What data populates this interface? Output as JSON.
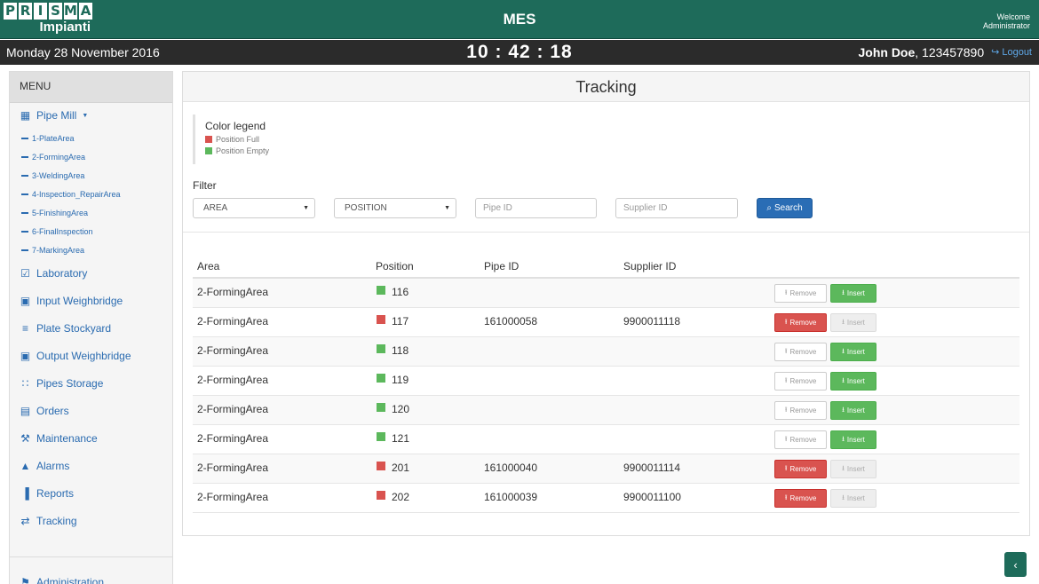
{
  "header": {
    "logo_letters": [
      "P",
      "R",
      "I",
      "S",
      "M",
      "A"
    ],
    "logo_sub": "Impianti",
    "app_title": "MES",
    "welcome": "Welcome",
    "user_role": "Administrator"
  },
  "status": {
    "date": "Monday 28 November 2016",
    "clock": "10 : 42 : 18",
    "user_name": "John Doe",
    "user_id": ", 123457890",
    "logout": "Logout"
  },
  "sidebar": {
    "title": "MENU",
    "pipe_mill": "Pipe Mill",
    "sub_items": [
      "1-PlateArea",
      "2-FormingArea",
      "3-WeldingArea",
      "4-Inspection_RepairArea",
      "5-FinishingArea",
      "6-FinalInspection",
      "7-MarkingArea"
    ],
    "items": [
      {
        "label": "Laboratory",
        "icon": "check-square-icon"
      },
      {
        "label": "Input Weighbridge",
        "icon": "weighbridge-icon"
      },
      {
        "label": "Plate Stockyard",
        "icon": "list-icon"
      },
      {
        "label": "Output Weighbridge",
        "icon": "weighbridge-icon"
      },
      {
        "label": "Pipes Storage",
        "icon": "grid-icon"
      },
      {
        "label": "Orders",
        "icon": "document-icon"
      },
      {
        "label": "Maintenance",
        "icon": "wrench-icon"
      },
      {
        "label": "Alarms",
        "icon": "bell-icon"
      },
      {
        "label": "Reports",
        "icon": "bar-chart-icon"
      },
      {
        "label": "Tracking",
        "icon": "transfer-icon"
      }
    ],
    "administration": "Administration"
  },
  "main": {
    "title": "Tracking",
    "legend": {
      "title": "Color legend",
      "full": "Position Full",
      "empty": "Position Empty",
      "full_color": "#d9534f",
      "empty_color": "#5cb85c"
    },
    "filter": {
      "title": "Filter",
      "area": "AREA",
      "position": "POSITION",
      "pipe_id_placeholder": "Pipe ID",
      "supplier_id_placeholder": "Supplier ID",
      "search": "Search"
    },
    "table": {
      "headers": {
        "area": "Area",
        "position": "Position",
        "pipe_id": "Pipe ID",
        "supplier_id": "Supplier ID"
      },
      "remove_label": "Remove",
      "insert_label": "Insert",
      "rows": [
        {
          "area": "2-FormingArea",
          "position": "116",
          "pipe_id": "",
          "supplier_id": "",
          "full": false
        },
        {
          "area": "2-FormingArea",
          "position": "117",
          "pipe_id": "161000058",
          "supplier_id": "9900011118",
          "full": true
        },
        {
          "area": "2-FormingArea",
          "position": "118",
          "pipe_id": "",
          "supplier_id": "",
          "full": false
        },
        {
          "area": "2-FormingArea",
          "position": "119",
          "pipe_id": "",
          "supplier_id": "",
          "full": false
        },
        {
          "area": "2-FormingArea",
          "position": "120",
          "pipe_id": "",
          "supplier_id": "",
          "full": false
        },
        {
          "area": "2-FormingArea",
          "position": "121",
          "pipe_id": "",
          "supplier_id": "",
          "full": false
        },
        {
          "area": "2-FormingArea",
          "position": "201",
          "pipe_id": "161000040",
          "supplier_id": "9900011114",
          "full": true
        },
        {
          "area": "2-FormingArea",
          "position": "202",
          "pipe_id": "161000039",
          "supplier_id": "9900011100",
          "full": true
        }
      ]
    }
  }
}
